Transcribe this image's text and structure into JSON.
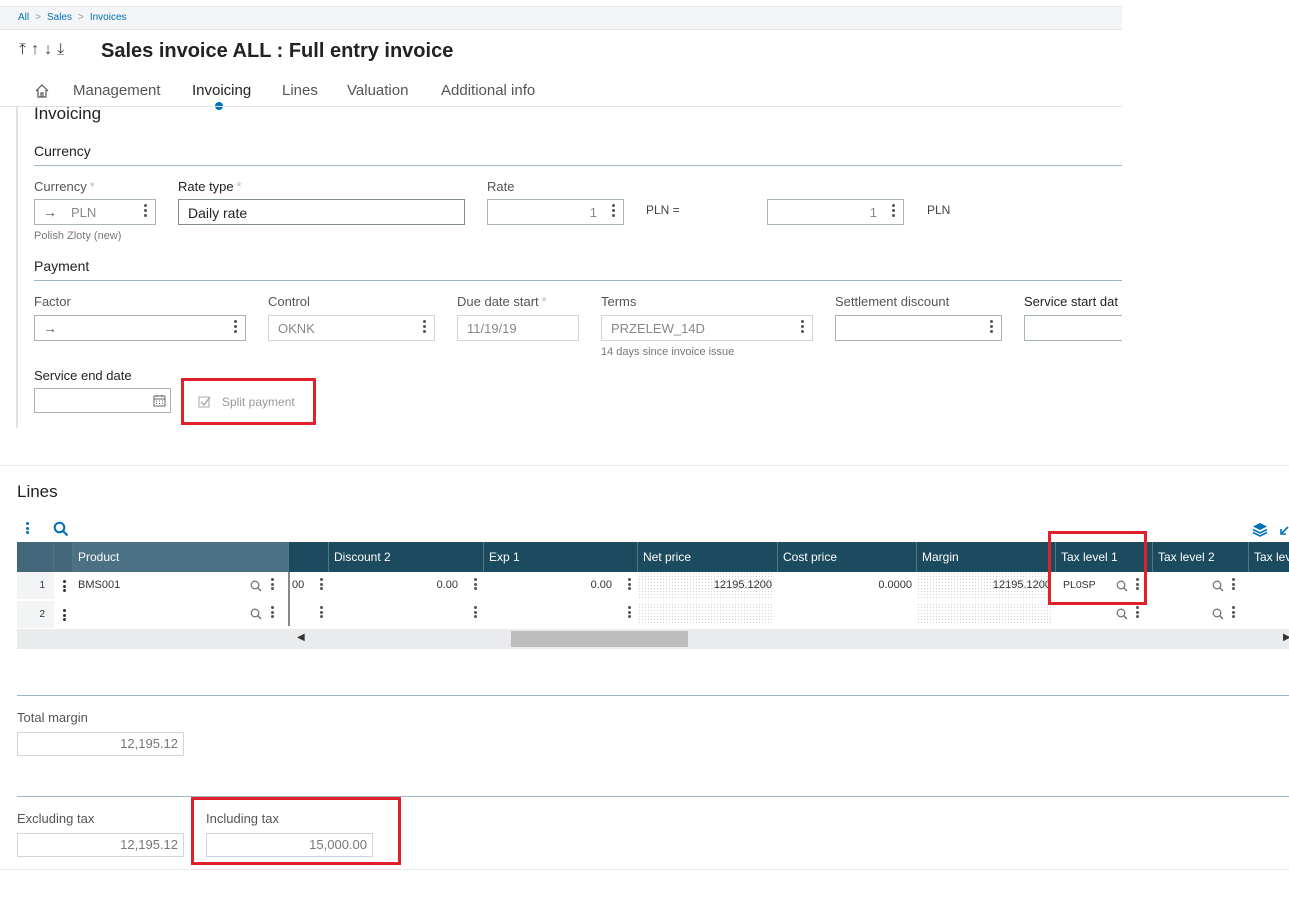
{
  "breadcrumb": {
    "items": [
      "All",
      "Sales",
      "Invoices"
    ]
  },
  "title": "Sales invoice ALL : Full entry invoice",
  "tabs": [
    "Management",
    "Invoicing",
    "Lines",
    "Valuation",
    "Additional info"
  ],
  "active_tab": "Invoicing",
  "invoicing": {
    "section_title": "Invoicing",
    "currency": {
      "section_label": "Currency",
      "currency_label": "Currency",
      "currency_value": "PLN",
      "currency_desc": "Polish Zloty (new)",
      "rate_type_label": "Rate type",
      "rate_type_value": "Daily rate",
      "rate_label": "Rate",
      "rate_value": "1",
      "pln_eq": "PLN =",
      "rate_value2": "1",
      "pln_suffix": "PLN"
    },
    "payment": {
      "section_label": "Payment",
      "factor_label": "Factor",
      "factor_value": "",
      "control_label": "Control",
      "control_value": "OKNK",
      "due_date_label": "Due date start",
      "due_date_value": "11/19/19",
      "terms_label": "Terms",
      "terms_value": "PRZELEW_14D",
      "terms_desc": "14 days since invoice issue",
      "settlement_label": "Settlement discount",
      "service_start_label": "Service start dat",
      "service_end_label": "Service end date",
      "split_payment_label": "Split payment"
    }
  },
  "lines": {
    "title": "Lines",
    "columns": [
      "Product",
      "Discount 2",
      "Exp 1",
      "Net price",
      "Cost price",
      "Margin",
      "Tax level 1",
      "Tax level 2",
      "Tax lev"
    ],
    "rows": [
      {
        "num": "1",
        "product": "BMS001",
        "partial": "00",
        "discount2": "0.00",
        "exp1": "0.00",
        "net_price": "12195.1200",
        "cost_price": "0.0000",
        "margin": "12195.1200",
        "tax1": "PL0SP"
      },
      {
        "num": "2",
        "product": "",
        "partial": "",
        "discount2": "",
        "exp1": "",
        "net_price": "",
        "cost_price": "",
        "margin": "",
        "tax1": ""
      }
    ]
  },
  "totals": {
    "total_margin_label": "Total margin",
    "total_margin_value": "12,195.12",
    "excl_tax_label": "Excluding tax",
    "excl_tax_value": "12,195.12",
    "incl_tax_label": "Including tax",
    "incl_tax_value": "15,000.00"
  },
  "colors": {
    "accent": "#0071b9",
    "grid_header": "#1c4a5e",
    "highlight": "#e0202a"
  }
}
